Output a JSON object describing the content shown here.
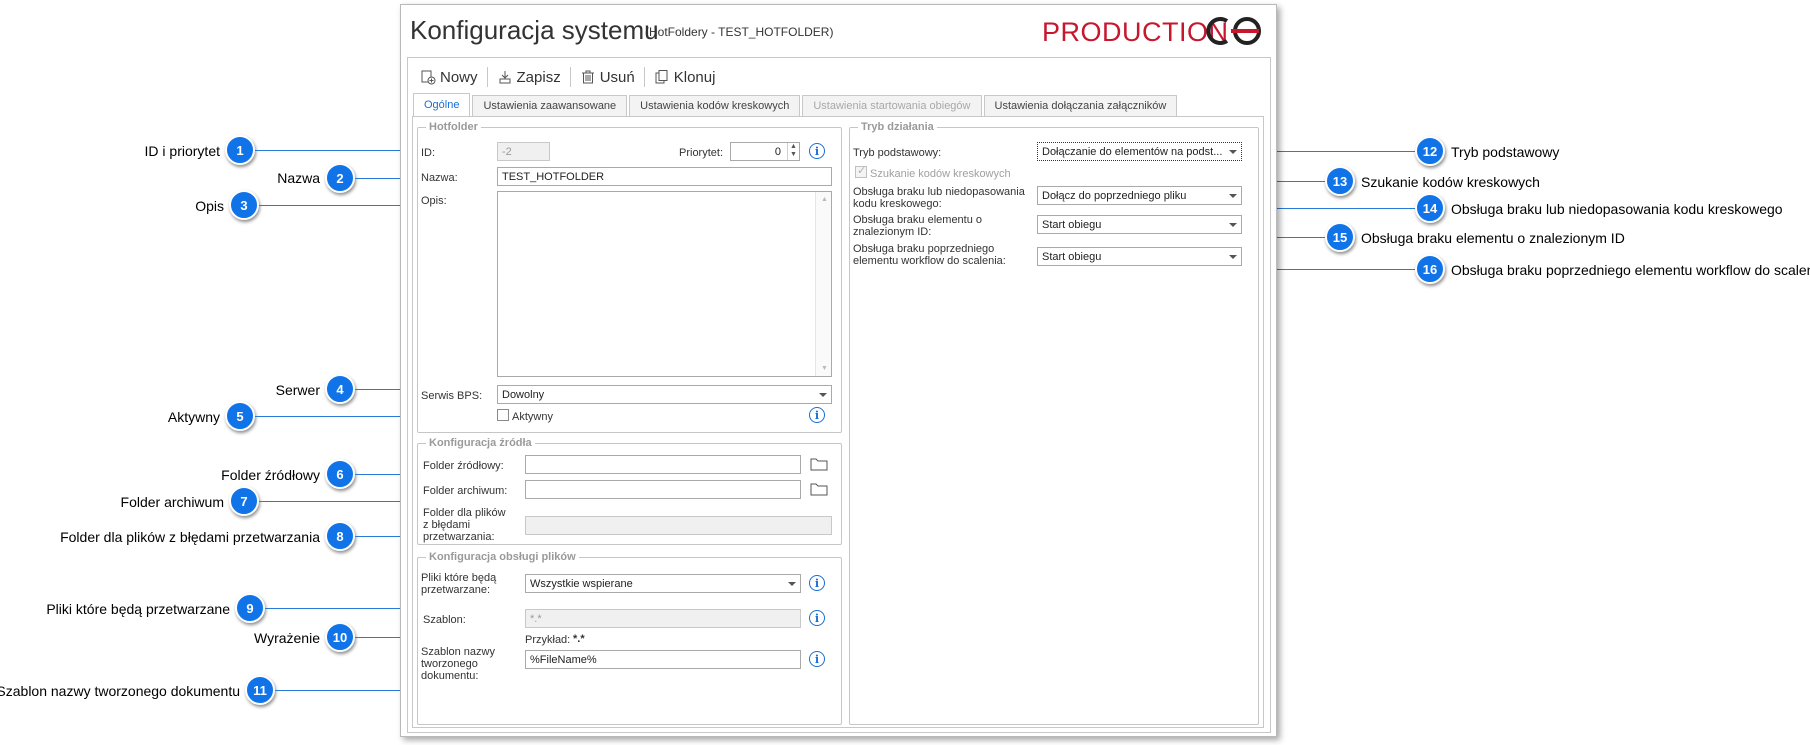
{
  "window": {
    "title": "Konfiguracja systemu",
    "subtitle": "(HotFoldery - TEST_HOTFOLDER)",
    "environment": "PRODUCTION",
    "environment_color": "#c6172f",
    "logo_icon": "wf-logo-icon"
  },
  "toolbar": {
    "new_label": "Nowy",
    "save_label": "Zapisz",
    "delete_label": "Usuń",
    "clone_label": "Klonuj"
  },
  "tabs": [
    {
      "label": "Ogólne",
      "state": "active"
    },
    {
      "label": "Ustawienia zaawansowane",
      "state": "normal"
    },
    {
      "label": "Ustawienia kodów kreskowych",
      "state": "normal"
    },
    {
      "label": "Ustawienia startowania obiegów",
      "state": "disabled"
    },
    {
      "label": "Ustawienia dołączania załączników",
      "state": "normal"
    }
  ],
  "hotfolder": {
    "legend": "Hotfolder",
    "id_label": "ID:",
    "id_value": "-2",
    "priority_label": "Priorytet:",
    "priority_value": "0",
    "name_label": "Nazwa:",
    "name_value": "TEST_HOTFOLDER",
    "description_label": "Opis:",
    "server_label": "Serwis BPS:",
    "server_value": "Dowolny",
    "active_label": "Aktywny",
    "active_checked": false
  },
  "source_config": {
    "legend": "Konfiguracja źródła",
    "source_folder_label": "Folder źródłowy:",
    "archive_folder_label": "Folder archiwum:",
    "error_folder_label": "Folder dla plików z błędami przetwarzania:"
  },
  "file_config": {
    "legend": "Konfiguracja obsługi plików",
    "files_label": "Pliki które będą przetwarzane:",
    "files_value": "Wszystkie wspierane",
    "template_label": "Szablon:",
    "template_value": "*.*",
    "example_label": "Przykład:",
    "example_value": "*.*",
    "doc_name_label": "Szablon nazwy tworzonego dokumentu:",
    "doc_name_value": "%FileName%"
  },
  "mode": {
    "legend": "Tryb działania",
    "base_mode_label": "Tryb podstawowy:",
    "base_mode_value": "Dołączanie do elementów na podst...",
    "barcode_search_label": "Szukanie kodów kreskowych",
    "barcode_search_checked": true,
    "missing_barcode_label": "Obsługa braku lub niedopasowania kodu kreskowego:",
    "missing_barcode_value": "Dołącz do poprzedniego pliku",
    "missing_element_label": "Obsługa braku elementu o znalezionym ID:",
    "missing_element_value": "Start obiegu",
    "missing_prev_label": "Obsługa braku poprzedniego elementu workflow do scalenia:",
    "missing_prev_value": "Start obiegu"
  },
  "callouts": [
    {
      "num": "1",
      "label": "ID i priorytet"
    },
    {
      "num": "2",
      "label": "Nazwa"
    },
    {
      "num": "3",
      "label": "Opis"
    },
    {
      "num": "4",
      "label": "Serwer"
    },
    {
      "num": "5",
      "label": "Aktywny"
    },
    {
      "num": "6",
      "label": "Folder źródłowy"
    },
    {
      "num": "7",
      "label": "Folder archiwum"
    },
    {
      "num": "8",
      "label": "Folder dla plików z błędami przetwarzania"
    },
    {
      "num": "9",
      "label": "Pliki które będą przetwarzane"
    },
    {
      "num": "10",
      "label": "Wyrażenie"
    },
    {
      "num": "11",
      "label": "Szablon nazwy tworzonego dokumentu"
    },
    {
      "num": "12",
      "label": "Tryb podstawowy"
    },
    {
      "num": "13",
      "label": "Szukanie kodów kreskowych"
    },
    {
      "num": "14",
      "label": "Obsługa braku lub niedopasowania kodu kreskowego"
    },
    {
      "num": "15",
      "label": "Obsługa braku elementu o znalezionym ID"
    },
    {
      "num": "16",
      "label": "Obsługa braku poprzedniego elementu workflow do scalenia"
    }
  ],
  "colors": {
    "marker": "#1074e8",
    "leader": "#2a7ad8",
    "active_tab": "#1a6fd1",
    "info_icon": "#1a6fd1"
  }
}
